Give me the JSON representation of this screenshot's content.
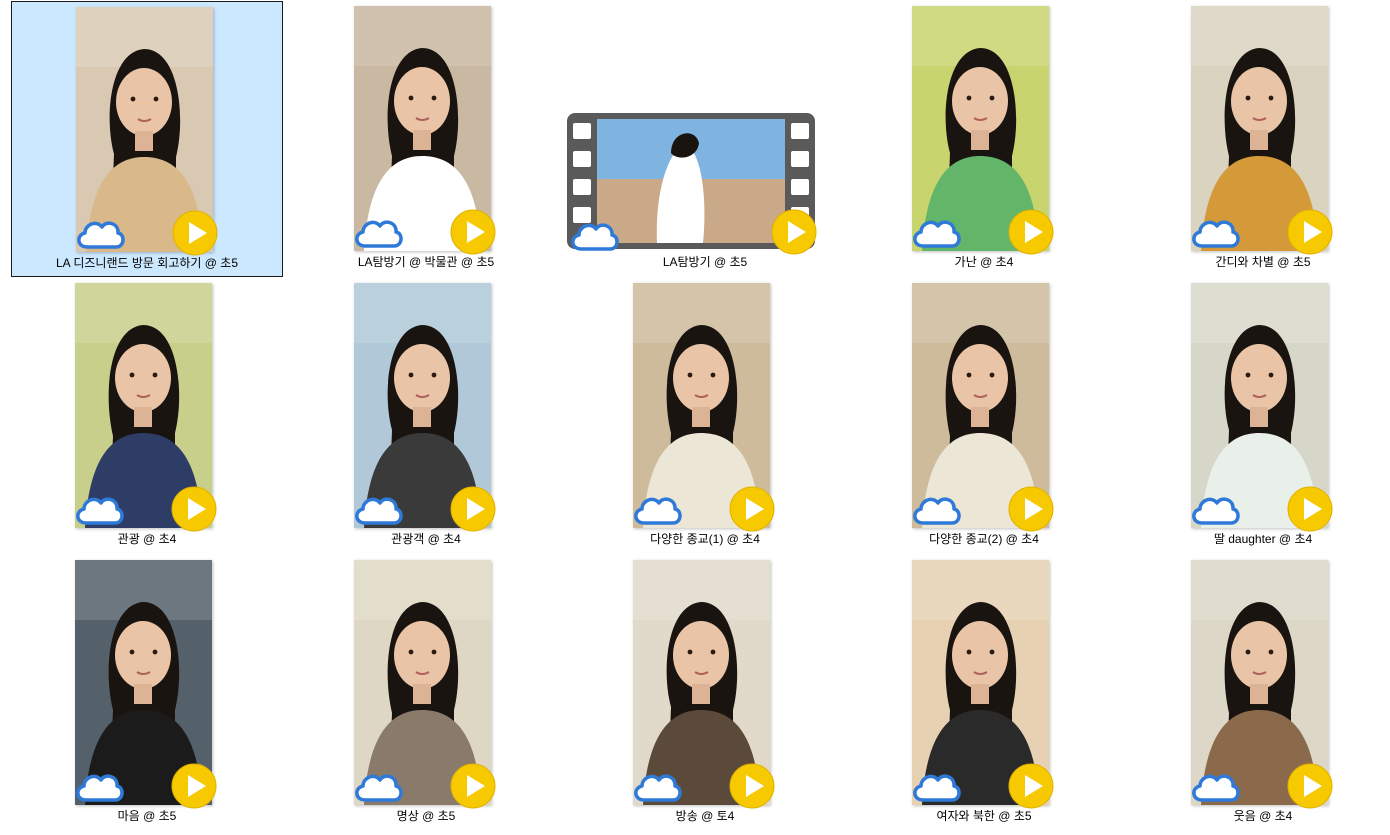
{
  "videos": [
    {
      "label": "LA 디즈니랜드 방문 회고하기 @ 초5",
      "selected": true,
      "bg": "#d9c9b3",
      "shirt": "#d9b98a",
      "style": "portrait"
    },
    {
      "label": "LA탐방기 @ 박물관 @ 초5",
      "selected": false,
      "bg": "#c9b8a2",
      "shirt": "#ffffff",
      "style": "portrait"
    },
    {
      "label": "LA탐방기 @ 초5",
      "selected": false,
      "bg": "#7fb3e0",
      "shirt": "#ffffff",
      "style": "film"
    },
    {
      "label": "가난 @ 초4",
      "selected": false,
      "bg": "#c8d46e",
      "shirt": "#63b56a",
      "style": "portrait"
    },
    {
      "label": "간디와 차별 @ 초5",
      "selected": false,
      "bg": "#d9d3c0",
      "shirt": "#d49a3a",
      "style": "portrait"
    },
    {
      "label": "관광 @ 초4",
      "selected": false,
      "bg": "#c8cf8a",
      "shirt": "#2d3d66",
      "style": "portrait"
    },
    {
      "label": "관광객 @ 초4",
      "selected": false,
      "bg": "#b0c8d8",
      "shirt": "#3a3a3a",
      "style": "portrait"
    },
    {
      "label": "다양한 종교(1) @ 초4",
      "selected": false,
      "bg": "#cdbb9c",
      "shirt": "#ece6d6",
      "style": "portrait"
    },
    {
      "label": "다양한 종교(2) @ 초4",
      "selected": false,
      "bg": "#cdbb9c",
      "shirt": "#ece6d6",
      "style": "portrait"
    },
    {
      "label": "딸 daughter @ 초4",
      "selected": false,
      "bg": "#d7d7c9",
      "shirt": "#e9efe9",
      "style": "portrait"
    },
    {
      "label": "마음 @ 초5",
      "selected": false,
      "bg": "#54606a",
      "shirt": "#1b1b1b",
      "style": "portrait"
    },
    {
      "label": "명상 @ 초5",
      "selected": false,
      "bg": "#ded7c4",
      "shirt": "#8a7a6a",
      "style": "portrait"
    },
    {
      "label": "방송 @ 토4",
      "selected": false,
      "bg": "#e1dacb",
      "shirt": "#5b4a3a",
      "style": "portrait"
    },
    {
      "label": "여자와 북한 @ 초5",
      "selected": false,
      "bg": "#e6d2b3",
      "shirt": "#2a2a2a",
      "style": "portrait"
    },
    {
      "label": "웃음 @ 초4",
      "selected": false,
      "bg": "#dcd7c6",
      "shirt": "#8a6a4a",
      "style": "portrait"
    }
  ],
  "icons": {
    "cloud": "cloud-sync-icon",
    "play": "play-icon",
    "film": "film-strip-icon"
  },
  "colors": {
    "selection_bg": "#cce8ff",
    "cloud_stroke": "#2f7ad8",
    "play_fill": "#f7c900"
  }
}
